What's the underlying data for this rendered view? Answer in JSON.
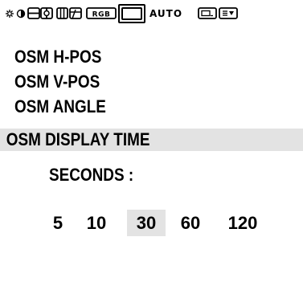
{
  "toolbar": {
    "icons": [
      {
        "name": "brightness-contrast-icon"
      },
      {
        "name": "size-position-icon"
      },
      {
        "name": "geometry-icon"
      },
      {
        "name": "rgb-icon",
        "label": "RGB"
      },
      {
        "name": "osm-settings-icon"
      },
      {
        "name": "auto-adjust-icon",
        "label": "AUTO"
      },
      {
        "name": "input-select-icon"
      },
      {
        "name": "information-icon"
      }
    ]
  },
  "menu": {
    "items": [
      {
        "label": "OSM H-POS"
      },
      {
        "label": "OSM V-POS"
      },
      {
        "label": "OSM ANGLE"
      },
      {
        "label": "OSM DISPLAY TIME",
        "selected": true
      }
    ]
  },
  "display_time": {
    "label": "SECONDS :",
    "options": [
      "5",
      "10",
      "30",
      "60",
      "120"
    ],
    "selected": "30"
  },
  "colors": {
    "background": "#ffffff",
    "highlight": "#e3e3e3",
    "text": "#000000"
  }
}
